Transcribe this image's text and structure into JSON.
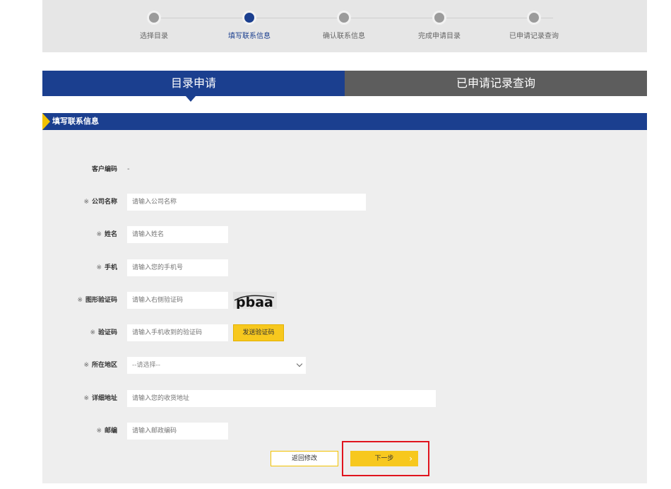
{
  "steps": [
    {
      "label": "选择目录",
      "active": false
    },
    {
      "label": "填写联系信息",
      "active": true
    },
    {
      "label": "确认联系信息",
      "active": false
    },
    {
      "label": "完成申请目录",
      "active": false
    },
    {
      "label": "已申请记录查询",
      "active": false
    }
  ],
  "tabs": {
    "apply": "目录申请",
    "history": "已申请记录查询"
  },
  "section": {
    "title": "填写联系信息"
  },
  "form": {
    "required_mark": "※",
    "customer_code": {
      "label": "客户编码",
      "value": "-"
    },
    "company": {
      "label": "公司名称",
      "placeholder": "请输入公司名称"
    },
    "name": {
      "label": "姓名",
      "placeholder": "请输入姓名"
    },
    "phone": {
      "label": "手机",
      "placeholder": "请输入您的手机号"
    },
    "captcha": {
      "label": "图形验证码",
      "placeholder": "请输入右侧验证码",
      "image_text": "pbaa"
    },
    "sms_code": {
      "label": "验证码",
      "placeholder": "请输入手机收到的验证码",
      "send_label": "发送验证码"
    },
    "region": {
      "label": "所在地区",
      "selected": "--请选择--"
    },
    "address": {
      "label": "详细地址",
      "placeholder": "请输入您的收货地址"
    },
    "zip": {
      "label": "邮编",
      "placeholder": "请输入邮政编码"
    }
  },
  "actions": {
    "back_label": "返回修改",
    "next_label": "下一步"
  },
  "colors": {
    "primary": "#1b3f8f",
    "accent": "#f7c81e",
    "tab_inactive": "#5d5d5d",
    "highlight": "#e0141e"
  }
}
